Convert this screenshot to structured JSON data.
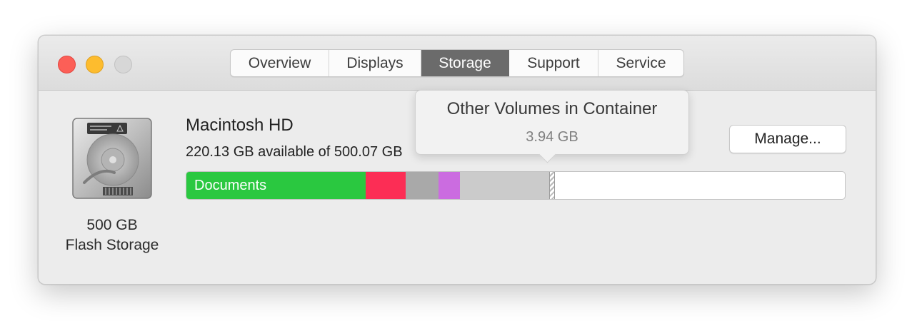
{
  "tabs": [
    {
      "label": "Overview",
      "active": false
    },
    {
      "label": "Displays",
      "active": false
    },
    {
      "label": "Storage",
      "active": true
    },
    {
      "label": "Support",
      "active": false
    },
    {
      "label": "Service",
      "active": false
    }
  ],
  "disk": {
    "icon": "hard-drive-icon",
    "capacity": "500 GB",
    "type": "Flash Storage"
  },
  "volume": {
    "name": "Macintosh HD",
    "available": "220.13 GB available of 500.07 GB"
  },
  "manage_label": "Manage...",
  "popover": {
    "title": "Other Volumes in Container",
    "value": "3.94 GB"
  },
  "storage_bar": {
    "segments": [
      {
        "label": "Documents",
        "color": "#2ac840"
      },
      {
        "label": "",
        "color": "#fc2d55"
      },
      {
        "label": "",
        "color": "#a9a9a9"
      },
      {
        "label": "",
        "color": "#cb6ce0"
      },
      {
        "label": "",
        "color": "#cbcbcb"
      },
      {
        "label": "",
        "color": "hatched"
      }
    ]
  }
}
